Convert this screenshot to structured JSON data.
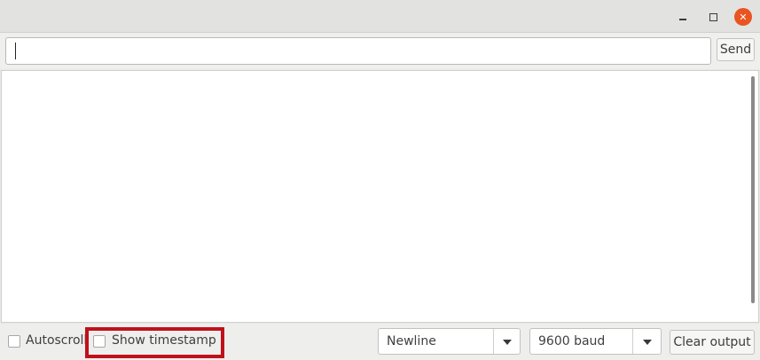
{
  "window": {
    "minimize_icon": "minimize-icon",
    "maximize_icon": "maximize-icon",
    "close_icon": "close-icon",
    "close_glyph": "✕",
    "close_color": "#e95420"
  },
  "send_row": {
    "input_value": "",
    "send_label": "Send"
  },
  "output": {
    "text": ""
  },
  "bottom": {
    "autoscroll_label": "Autoscroll",
    "autoscroll_checked": false,
    "timestamp_label": "Show timestamp",
    "timestamp_checked": false,
    "highlight_color": "#c0111a",
    "line_ending": "Newline",
    "baud_rate": "9600 baud",
    "clear_label": "Clear output"
  }
}
